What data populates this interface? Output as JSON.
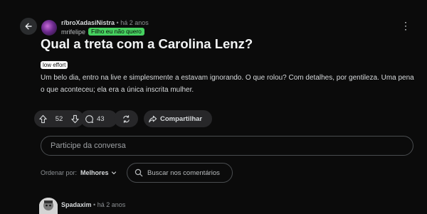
{
  "post": {
    "subreddit": "r/broXadasiNistra",
    "separator": "•",
    "time": "há 2 anos",
    "author": "mrifelipe",
    "author_flair": "Filho eu não quero",
    "more_icon": "⋮",
    "title": "Qual a treta com a Carolina Lenz?",
    "post_flair": "low effort",
    "body": "Um belo dia, entro na live e simplesmente a estavam ignorando. O que rolou? Com detalhes, por gentileza. Uma pena o que aconteceu; ela era a única inscrita mulher."
  },
  "actions": {
    "votes": "52",
    "comments": "43",
    "share_label": "Compartilhar"
  },
  "comment_box": {
    "placeholder": "Participe da conversa"
  },
  "sort": {
    "label": "Ordenar por:",
    "value": "Melhores"
  },
  "search_comments": {
    "placeholder": "Buscar nos comentários"
  },
  "first_comment": {
    "author": "Spadaxim",
    "separator": "•",
    "time": "há 2 anos"
  },
  "colors": {
    "background": "#0b0b0b",
    "author_flair_bg": "#46d160",
    "pill_bg": "#272729"
  }
}
